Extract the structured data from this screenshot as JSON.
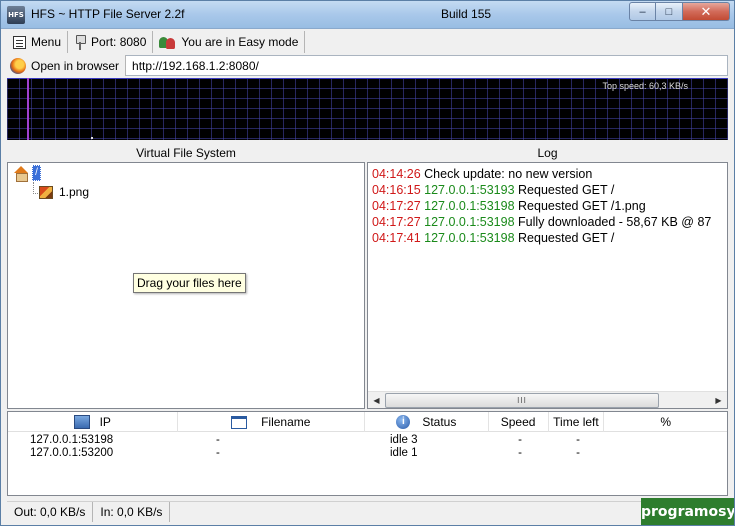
{
  "window": {
    "title": "HFS ~ HTTP File Server 2.2f",
    "build": "Build 155",
    "app_icon_text": "HFS",
    "controls": {
      "minimize": "–",
      "maximize": "□",
      "close": "✕"
    }
  },
  "toolbar": {
    "menu_label": "Menu",
    "port_label": "Port: 8080",
    "mode_label": "You are in Easy mode"
  },
  "address": {
    "open_browser_label": "Open in browser",
    "url": "http://192.168.1.2:8080/"
  },
  "graph": {
    "top_speed": "Top speed: 60,3 KB/s"
  },
  "vfs": {
    "header": "Virtual File System",
    "root_label": "/",
    "files": [
      {
        "name": "1.png"
      }
    ],
    "drag_tip": "Drag your files here"
  },
  "log": {
    "header": "Log",
    "entries": [
      {
        "time": "04:14:26",
        "ip": "",
        "msg": "Check update: no new version"
      },
      {
        "time": "04:16:15",
        "ip": "127.0.0.1:53193",
        "msg": "Requested GET /"
      },
      {
        "time": "04:17:27",
        "ip": "127.0.0.1:53198",
        "msg": "Requested GET /1.png"
      },
      {
        "time": "04:17:27",
        "ip": "127.0.0.1:53198",
        "msg": "Fully downloaded - 58,67 KB @ 87"
      },
      {
        "time": "04:17:41",
        "ip": "127.0.0.1:53198",
        "msg": "Requested GET /"
      }
    ],
    "scroll_thumb": "III"
  },
  "connections": {
    "columns": {
      "ip": "IP",
      "filename": "Filename",
      "status": "Status",
      "speed": "Speed",
      "time_left": "Time left",
      "percent": "%"
    },
    "rows": [
      {
        "ip": "127.0.0.1:53198",
        "filename": "-",
        "status": "idle 3",
        "speed": "-",
        "time_left": "-"
      },
      {
        "ip": "127.0.0.1:53200",
        "filename": "-",
        "status": "idle 1",
        "speed": "-",
        "time_left": "-"
      }
    ]
  },
  "statusbar": {
    "out": "Out: 0,0 KB/s",
    "in": "In: 0,0 KB/s"
  },
  "watermark": "programosy.pl"
}
